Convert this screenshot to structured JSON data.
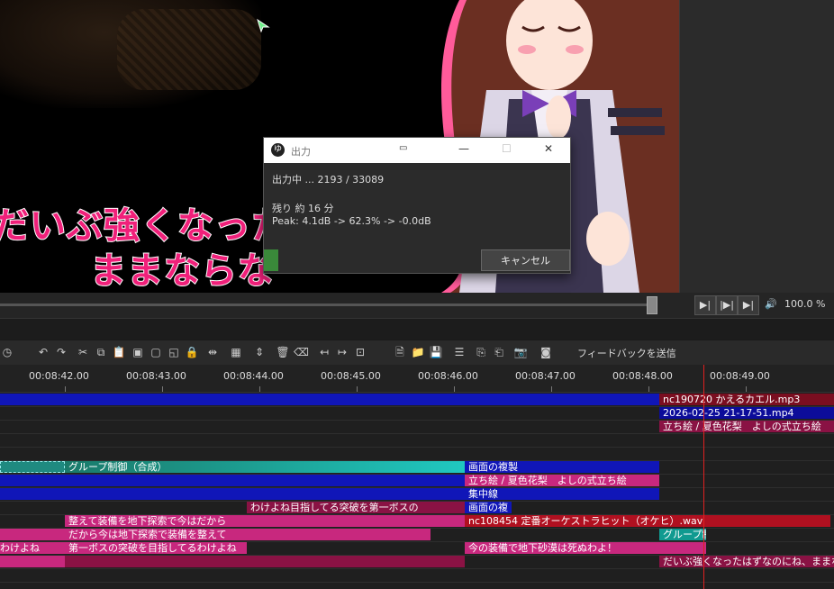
{
  "preview": {
    "subtitle_line1": "だいぶ強くなったは",
    "subtitle_line2": "ままならな"
  },
  "player": {
    "zoom": "100.0 %",
    "play_label": "▶|",
    "step_label": "|▶|",
    "next_label": "▶|",
    "volume_label": "🔊"
  },
  "toolbar": {
    "feedback_label": "フィードバックを送信"
  },
  "ruler": {
    "ticks": [
      "00:08:42.00",
      "00:08:43.00",
      "00:08:44.00",
      "00:08:45.00",
      "00:08:46.00",
      "00:08:47.00",
      "00:08:48.00",
      "00:08:49.00"
    ]
  },
  "clips": {
    "c1": "nc190720 かえるカエル.mp3",
    "c2": "2026-02-25 21-17-51.mp4",
    "c3": "立ち絵 / 夏色花梨　よしの式立ち絵",
    "c4": "グループ制御（合成）",
    "c5": "画面の複製",
    "c6": "立ち絵 / 夏色花梨　よしの式立ち絵",
    "c7": "集中線",
    "c8": "わけよね目指してる突破を第一ボスの",
    "c9": "画面の複",
    "c10": "整えて装備を地下探索で今はだから",
    "c11": "nc108454 定番オーケストラヒット（オケヒ）.wav",
    "c12": "だから今は地下探索で装備を整えて",
    "c13": "グループ制",
    "c14": "わけよね",
    "c15": "第一ボスの突破を目指してるわけよね",
    "c16": "今の装備で地下砂漠は死ぬわよ！",
    "c17": "だいぶ強くなったはずなのにね、ままならないわね"
  },
  "dialog": {
    "app_icon": "ゆ",
    "title": "出力",
    "status": "出力中 ... 2193 / 33089",
    "remaining": "残り 約 16 分",
    "peak": "Peak: 4.1dB -> 62.3% -> -0.0dB",
    "cancel_label": "キャンセル",
    "minimize": "—",
    "maximize": "☐",
    "close": "✕",
    "progress": 0.066
  },
  "colors": {
    "accent_pink": "#c8287e",
    "clip_blue": "#1016b8",
    "playhead": "#e02020",
    "progress_green": "#3a8a3a"
  }
}
